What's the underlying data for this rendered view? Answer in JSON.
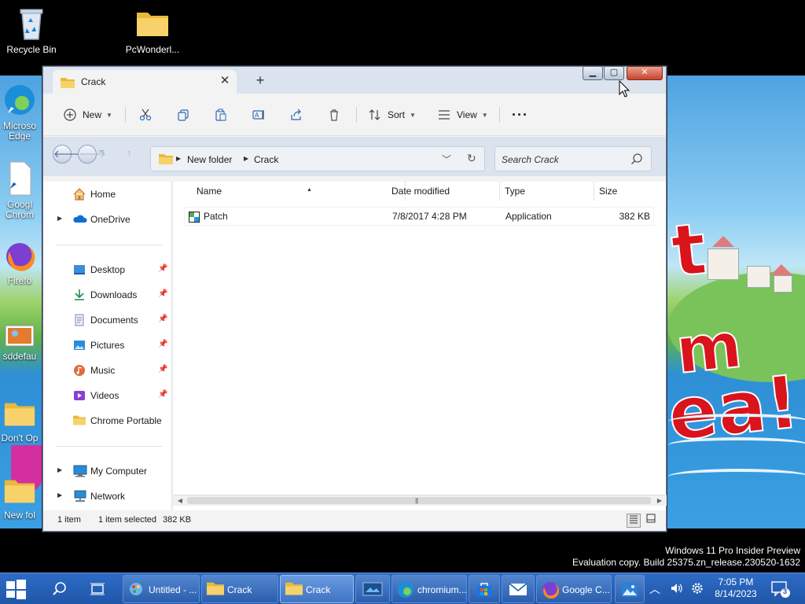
{
  "desktop": {
    "icons": [
      {
        "label": "Recycle Bin",
        "icon": "recycle-bin-icon"
      },
      {
        "label": "PcWonderl...",
        "icon": "folder-icon"
      },
      {
        "label": "Microso Edge",
        "icon": "edge-icon"
      },
      {
        "label": "Googl Chrom",
        "icon": "file-shortcut-icon"
      },
      {
        "label": "Firefo",
        "icon": "firefox-icon"
      },
      {
        "label": "sddefau",
        "icon": "image-icon"
      },
      {
        "label": "Don't Op",
        "icon": "folder-icon"
      },
      {
        "label": "New fol",
        "icon": "folder-icon"
      }
    ],
    "wallpaper_text": [
      "t",
      "m",
      "ea!"
    ],
    "watermark": {
      "line1": "Windows 11 Pro Insider Preview",
      "line2": "Evaluation copy. Build 25375.zn_release.230520-1632"
    }
  },
  "explorer": {
    "tab_title": "Crack",
    "toolbar": {
      "new_label": "New",
      "sort_label": "Sort",
      "view_label": "View",
      "more_label": "···"
    },
    "address": {
      "crumbs": [
        "New folder",
        "Crack"
      ]
    },
    "search": {
      "placeholder": "Search Crack"
    },
    "nav": {
      "home": "Home",
      "onedrive": "OneDrive",
      "quick_access": [
        {
          "label": "Desktop",
          "icon": "desktop-icon"
        },
        {
          "label": "Downloads",
          "icon": "downloads-icon"
        },
        {
          "label": "Documents",
          "icon": "documents-icon"
        },
        {
          "label": "Pictures",
          "icon": "pictures-icon"
        },
        {
          "label": "Music",
          "icon": "music-icon"
        },
        {
          "label": "Videos",
          "icon": "videos-icon"
        },
        {
          "label": "Chrome Portable",
          "icon": "folder-icon"
        }
      ],
      "my_computer": "My Computer",
      "network": "Network"
    },
    "columns": {
      "name": "Name",
      "date": "Date modified",
      "type": "Type",
      "size": "Size"
    },
    "files": [
      {
        "name": "Patch",
        "date": "7/8/2017 4:28 PM",
        "type": "Application",
        "size": "382 KB",
        "icon": "application-icon"
      }
    ],
    "status": {
      "count": "1 item",
      "selected": "1 item selected",
      "selected_size": "382 KB"
    }
  },
  "taskbar": {
    "apps": [
      {
        "label": "Untitled - ...",
        "icon": "paint-icon"
      },
      {
        "label": "Crack",
        "icon": "folder-icon"
      },
      {
        "label": "Crack",
        "icon": "folder-icon",
        "active": true
      },
      {
        "label": "",
        "icon": "media-icon"
      },
      {
        "label": "chromium...",
        "icon": "edge-icon"
      },
      {
        "label": "",
        "icon": "store-icon"
      },
      {
        "label": "",
        "icon": "mail-icon"
      },
      {
        "label": "Google C...",
        "icon": "firefox-icon"
      },
      {
        "label": "",
        "icon": "photos-icon"
      }
    ],
    "clock": {
      "time": "7:05 PM",
      "date": "8/14/2023"
    },
    "notifications": "3"
  },
  "colors": {
    "taskbar": "#2056a8",
    "accent": "#0067c0",
    "close": "#c9442a"
  }
}
